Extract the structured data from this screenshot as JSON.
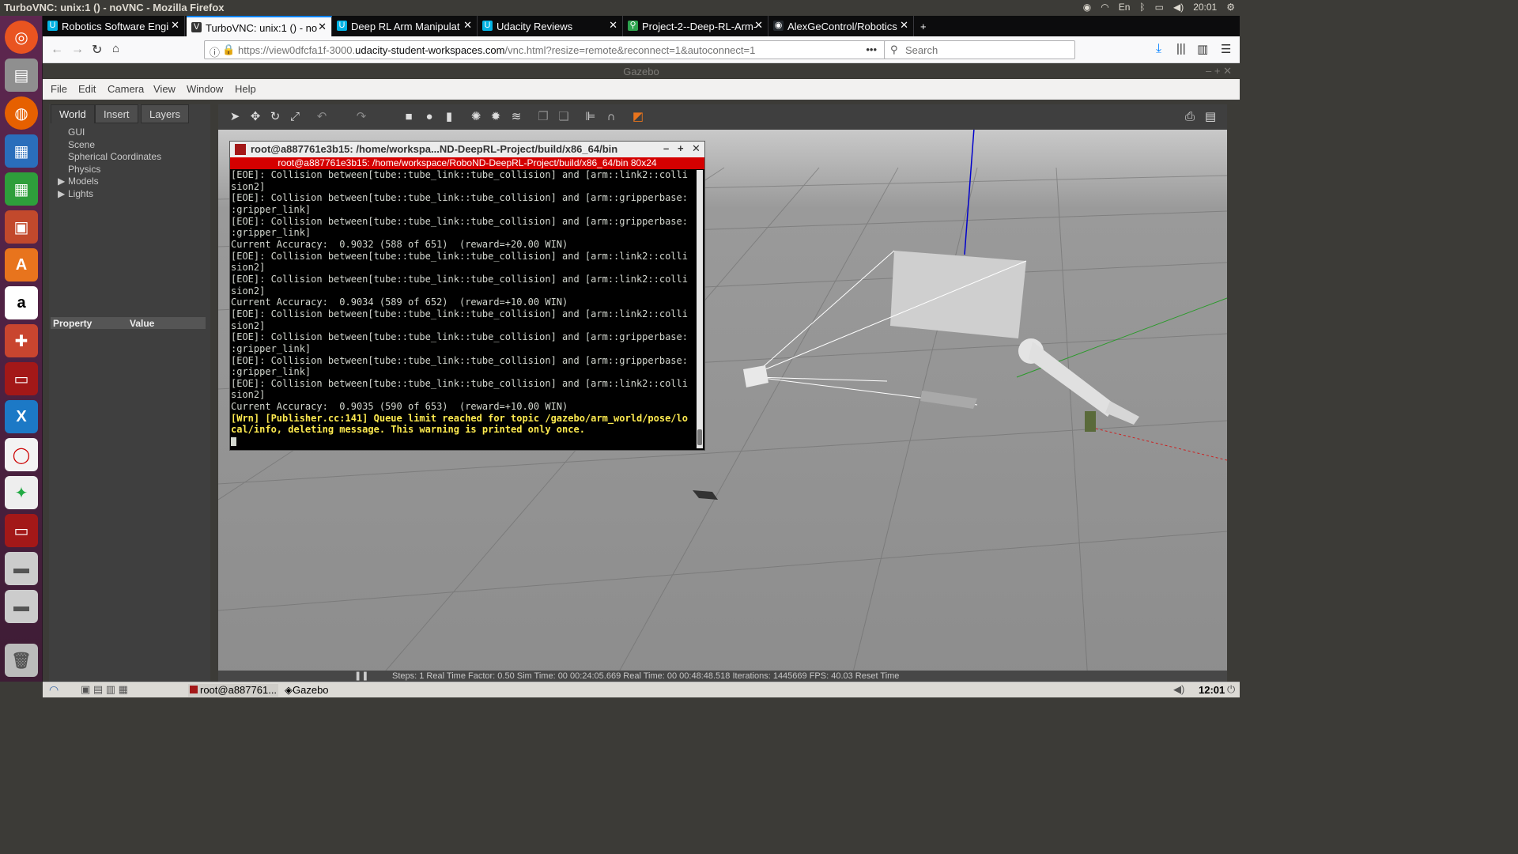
{
  "ubuntu_bar": {
    "title": "TurboVNC: unix:1 () - noVNC - Mozilla Firefox",
    "lang": "En",
    "time": "20:01"
  },
  "launcher": {
    "icons": [
      "ubuntu-dash-icon",
      "files-icon",
      "firefox-icon",
      "writer-icon",
      "calc-icon",
      "impress-icon",
      "software-center-icon",
      "amazon-icon",
      "settings-icon",
      "turbovnc-icon",
      "vscode-icon",
      "app-icon",
      "spyder-icon",
      "turbovnc-icon-2",
      "drive-icon",
      "drive-icon-2",
      "trash-icon"
    ]
  },
  "tabs": [
    {
      "label": "Robotics Software Engi",
      "icon": "U",
      "color": "#02b3e4"
    },
    {
      "label": "TurboVNC: unix:1 () - no",
      "icon": "V",
      "color": "#333"
    },
    {
      "label": "Deep RL Arm Manipulat",
      "icon": "U",
      "color": "#02b3e4"
    },
    {
      "label": "Udacity Reviews",
      "icon": "U",
      "color": "#02b3e4"
    },
    {
      "label": "Project-2--Deep-RL-Arm-",
      "icon": "⚲",
      "color": "#2ea44f"
    },
    {
      "label": "AlexGeControl/Robotics",
      "icon": "◉",
      "color": "#24292e"
    }
  ],
  "nav": {
    "url_pre": "https://view0dfcfa1f-3000.",
    "url_host": "udacity-student-workspaces.com",
    "url_post": "/vnc.html?resize=remote&reconnect=1&autoconnect=1",
    "search_placeholder": "Search"
  },
  "gazebo": {
    "title": "Gazebo",
    "menu": [
      "File",
      "Edit",
      "Camera",
      "View",
      "Window",
      "Help"
    ],
    "left_tabs": [
      "World",
      "Insert",
      "Layers"
    ],
    "tree": [
      "GUI",
      "Scene",
      "Spherical Coordinates",
      "Physics",
      "Models",
      "Lights"
    ],
    "prop_header": {
      "property": "Property",
      "value": "Value"
    },
    "status": "Steps: 1    Real Time Factor: 0.50    Sim Time: 00 00:24:05.669   Real Time: 00 00:48:48.518   Iterations: 1445669    FPS: 40.03    Reset Time"
  },
  "terminal": {
    "title": "root@a887761e3b15: /home/workspa...ND-DeepRL-Project/build/x86_64/bin",
    "subtitle": "root@a887761e3b15: /home/workspace/RoboND-DeepRL-Project/build/x86_64/bin 80x24",
    "lines": [
      "[EOE]: Collision between[tube::tube_link::tube_collision] and [arm::link2::colli",
      "sion2]",
      "[EOE]: Collision between[tube::tube_link::tube_collision] and [arm::gripperbase:",
      ":gripper_link]",
      "[EOE]: Collision between[tube::tube_link::tube_collision] and [arm::gripperbase:",
      ":gripper_link]",
      "Current Accuracy:  0.9032 (588 of 651)  (reward=+20.00 WIN)",
      "[EOE]: Collision between[tube::tube_link::tube_collision] and [arm::link2::colli",
      "sion2]",
      "[EOE]: Collision between[tube::tube_link::tube_collision] and [arm::link2::colli",
      "sion2]",
      "Current Accuracy:  0.9034 (589 of 652)  (reward=+10.00 WIN)",
      "[EOE]: Collision between[tube::tube_link::tube_collision] and [arm::link2::colli",
      "sion2]",
      "[EOE]: Collision between[tube::tube_link::tube_collision] and [arm::gripperbase:",
      ":gripper_link]",
      "[EOE]: Collision between[tube::tube_link::tube_collision] and [arm::gripperbase:",
      ":gripper_link]",
      "[EOE]: Collision between[tube::tube_link::tube_collision] and [arm::link2::colli",
      "sion2]",
      "Current Accuracy:  0.9035 (590 of 653)  (reward=+10.00 WIN)"
    ],
    "warn_lines": [
      "[Wrn] [Publisher.cc:141] Queue limit reached for topic /gazebo/arm_world/pose/lo",
      "cal/info, deleting message. This warning is printed only once."
    ]
  },
  "taskbar": {
    "items": [
      "root@a887761...",
      "Gazebo"
    ],
    "time": "12:01"
  }
}
